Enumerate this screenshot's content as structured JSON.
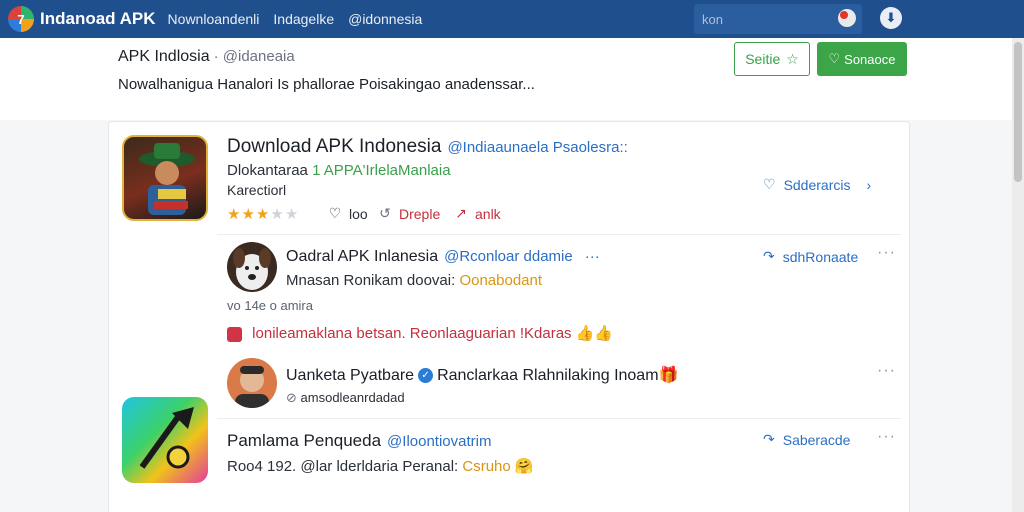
{
  "topbar": {
    "brand": "Indanoad APK",
    "nav": [
      "Nownloandenli",
      "Indagelke",
      "@idonnesia"
    ],
    "search_placeholder": "kon",
    "download_icon": "download-icon",
    "notification_icon": "notification-icon"
  },
  "header": {
    "title": "APK Indlosia",
    "handle": "· @idaneaia",
    "description": "Nowalhanigua Hanalori Is phallorae Poisakingao anadenssar...",
    "outline_button": "Seitie",
    "primary_button": "Sonaoce"
  },
  "app": {
    "title": "Download APK Indonesia",
    "handle": "@Indiaaunaela Psaolesra::",
    "subtitle_prefix": "Dlokantaraa",
    "subtitle_green": "1 APPA'IrlelaManlaia",
    "category": "Karectiorl",
    "rating": 3.5,
    "like_count": "loo",
    "reply_label": "Dreple",
    "share_label": "anlk",
    "side_action": "Sdderarcis"
  },
  "comments": [
    {
      "name": "Oadral APK Inlanesia",
      "handle": "@Rconloar ddamie",
      "text": "Mnasan Ronikam doovai:",
      "text_orange": "Oonabodant",
      "side_action": "sdhRonaate",
      "meta": "vo 14e o amira",
      "highlight": "lonileamaklana betsan. Reonlaaguarian !Kdaras",
      "highlight_emoji": "👍👍"
    },
    {
      "name": "Uanketa Pyatbare",
      "tagline": "Ranclarkaa Rlahnilaking Inoam",
      "tagline_emoji": "🎁",
      "subtext": "amsodleanrdadad"
    },
    {
      "name": "Pamlama Penqueda",
      "handle": "@Iloontiovatrim",
      "text": "Roo4 192. @lar lderldaria Peranal:",
      "text_orange": "Csruho",
      "text_emoji": "🤗",
      "side_action": "Saberacde"
    }
  ]
}
